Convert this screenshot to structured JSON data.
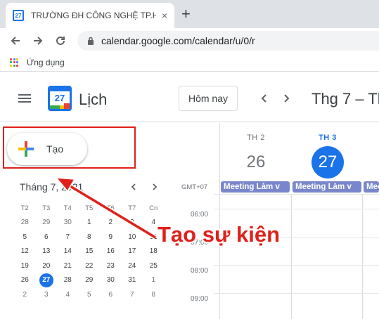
{
  "browser": {
    "tab_title": "TRƯỜNG ĐH CÔNG NGHỆ TP.HCM",
    "tab_favicon_text": "27",
    "tab_close": "×",
    "new_tab": "+",
    "url": "calendar.google.com/calendar/u/0/r",
    "bookmark_label": "Ứng dụng"
  },
  "header": {
    "logo_number": "27",
    "app_name": "Lịch",
    "today_label": "Hôm nay",
    "range_title": "Thg 7 – Th"
  },
  "create": {
    "label": "Tạo"
  },
  "mini_calendar": {
    "title": "Tháng 7, 2021",
    "weekdays": [
      "T2",
      "T3",
      "T4",
      "T5",
      "T6",
      "T7",
      "Cn"
    ],
    "weeks": [
      [
        "28",
        "29",
        "30",
        "1",
        "2",
        "3",
        "4"
      ],
      [
        "5",
        "6",
        "7",
        "8",
        "9",
        "10",
        "11"
      ],
      [
        "12",
        "13",
        "14",
        "15",
        "16",
        "17",
        "18"
      ],
      [
        "19",
        "20",
        "21",
        "22",
        "23",
        "24",
        "25"
      ],
      [
        "26",
        "27",
        "28",
        "29",
        "30",
        "31",
        "1"
      ],
      [
        "2",
        "3",
        "4",
        "5",
        "6",
        "7",
        "8"
      ]
    ],
    "today": "27"
  },
  "week_view": {
    "days": [
      {
        "dow": "TH 2",
        "num": "26",
        "active": false
      },
      {
        "dow": "TH 3",
        "num": "27",
        "active": true
      }
    ],
    "timezone": "GMT+07",
    "events": [
      "Meeting Làm v",
      "Meeting Làm v",
      "Meeting Làm v"
    ],
    "times": [
      "06:00",
      "07:00",
      "08:00",
      "09:00"
    ]
  },
  "annotation": {
    "text": "Tạo sự kiện"
  },
  "colors": {
    "accent": "#1a73e8",
    "event": "#7986cb",
    "annotation": "#e0201a"
  }
}
